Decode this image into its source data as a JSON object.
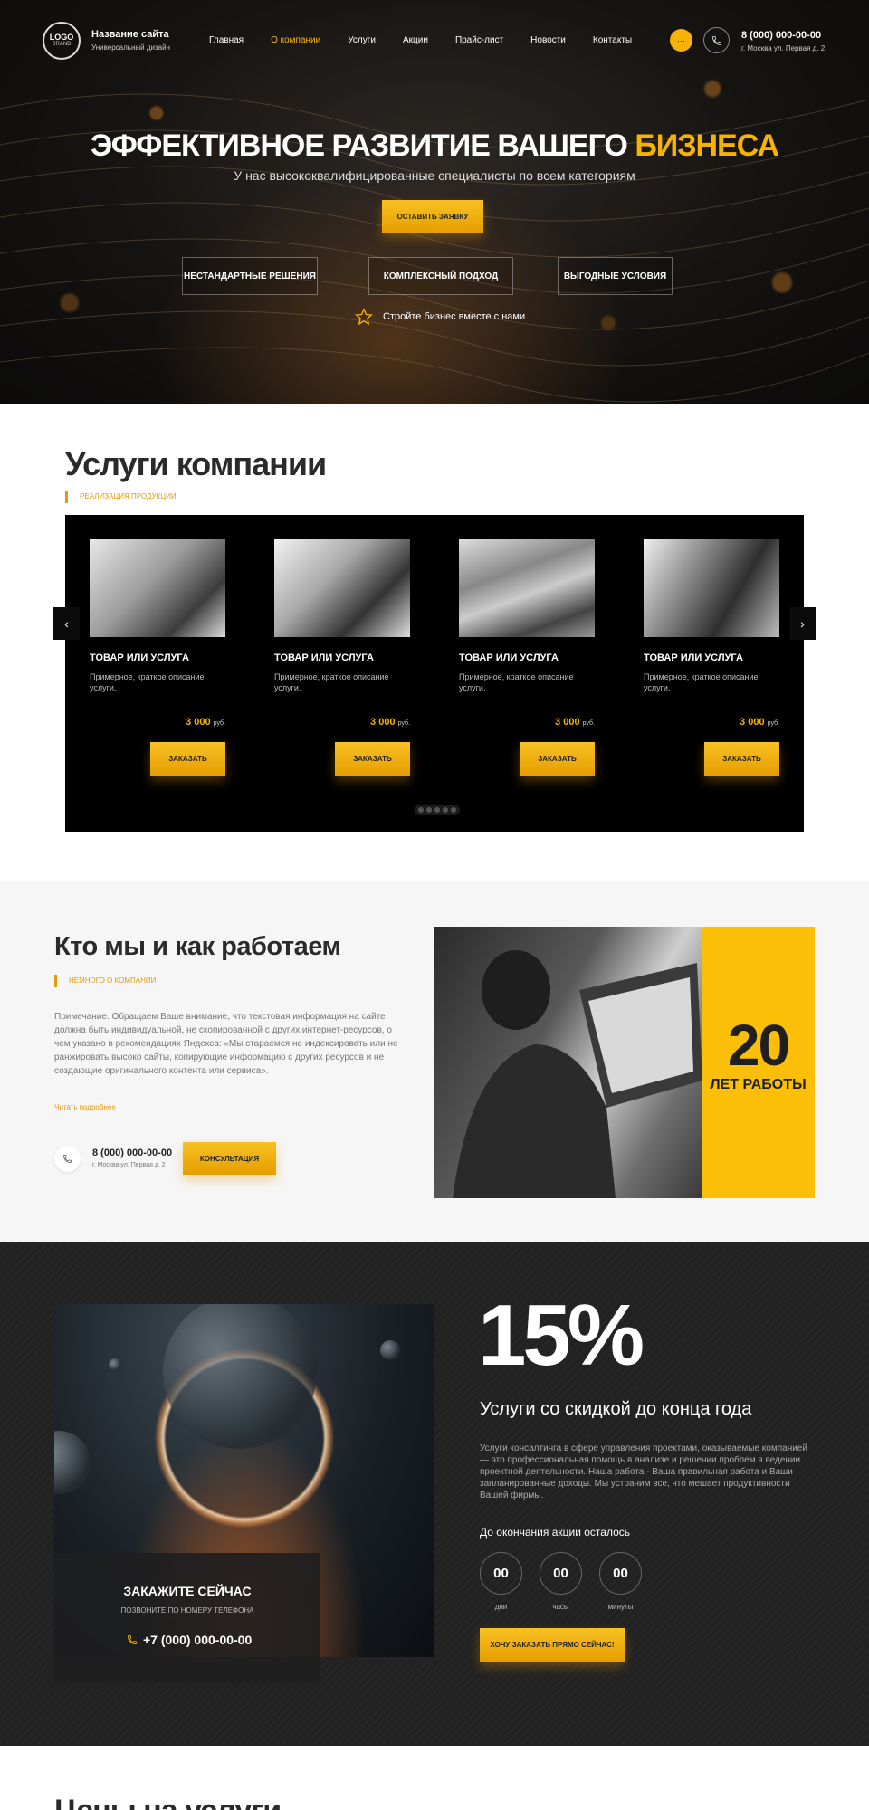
{
  "header": {
    "logo_line1": "LOGO",
    "logo_line2": "BRAND",
    "site_name": "Название сайта",
    "site_subtitle": "Универсальный дизайн",
    "nav": [
      "Главная",
      "О компании",
      "Услуги",
      "Акции",
      "Прайс-лист",
      "Новости",
      "Контакты"
    ],
    "nav_active_index": 1,
    "menu_icon": "ellipsis-icon",
    "phone": "8 (000) 000-00-00",
    "address": "г. Москва ул. Первая д. 2"
  },
  "hero": {
    "title_main": "ЭФФЕКТИВНОЕ РАЗВИТИЕ ВАШЕГО",
    "title_highlight": "БИЗНЕСА",
    "subtitle": "У нас высококвалифицированные специалисты по всем категориям",
    "button": "ОСТАВИТЬ ЗАЯВКУ",
    "features": [
      "НЕСТАНДАРТНЫЕ РЕШЕНИЯ",
      "КОМПЛЕКСНЫЙ ПОДХОД",
      "ВЫГОДНЫЕ УСЛОВИЯ"
    ],
    "cta": "Стройте бизнес вместе с нами"
  },
  "services": {
    "title": "Услуги компании",
    "label": "РЕАЛИЗАЦИЯ ПРОДУКЦИИ",
    "cards": [
      {
        "title": "ТОВАР ИЛИ УСЛУГА",
        "desc": "Примерное, краткое описание услуги.",
        "price": "3 000",
        "currency": "руб.",
        "button": "ЗАКАЗАТЬ"
      },
      {
        "title": "ТОВАР ИЛИ УСЛУГА",
        "desc": "Примерное, краткое описание услуги.",
        "price": "3 000",
        "currency": "руб.",
        "button": "ЗАКАЗАТЬ"
      },
      {
        "title": "ТОВАР ИЛИ УСЛУГА",
        "desc": "Примерное, краткое описание услуги.",
        "price": "3 000",
        "currency": "руб.",
        "button": "ЗАКАЗАТЬ"
      },
      {
        "title": "ТОВАР ИЛИ УСЛУГА",
        "desc": "Примерное, краткое описание услуги.",
        "price": "3 000",
        "currency": "руб.",
        "button": "ЗАКАЗАТЬ"
      }
    ]
  },
  "about": {
    "title": "Кто мы и как работаем",
    "label": "НЕМНОГО О КОМПАНИИ",
    "text": "Примечание. Обращаем Ваше внимание, что текстовая информация на сайте должна быть индивидуальной, не скопированной с других интернет-ресурсов, о чем указано в рекомендациях Яндекса: «Мы стараемся не индексировать или не ранжировать высоко сайты, копирующие информацию с других ресурсов и не создающие оригинального контента или сервиса».",
    "read_more": "Читать подробнее",
    "phone": "8 (000) 000-00-00",
    "address": "г. Москва ул. Первая д. 2",
    "button": "КОНСУЛЬТАЦИЯ",
    "years_number": "20",
    "years_label": "ЛЕТ РАБОТЫ"
  },
  "promo": {
    "percent": "15%",
    "title": "Услуги со скидкой до конца года",
    "text": "Услуги консалтинга в сфере управления проектами, оказываемые компанией — это профессиональная помощь в анализе и решении проблем в ведении проектной деятельности. Наша работа - Ваша правильная работа и Ваши запланированные доходы. Мы устраним все, что мешает продуктивности Вашей фирмы.",
    "countdown_label": "До окончания акции осталось",
    "timers": [
      {
        "value": "00",
        "label": "дни"
      },
      {
        "value": "00",
        "label": "часы"
      },
      {
        "value": "00",
        "label": "минуты"
      }
    ],
    "button": "ХОЧУ ЗАКАЗАТЬ ПРЯМО СЕЙЧАС!",
    "order_title": "ЗАКАЖИТЕ СЕЙЧАС",
    "order_subtitle": "ПОЗВОНИТЕ ПО НОМЕРУ ТЕЛЕФОНА",
    "order_phone": "+7 (000) 000-00-00"
  },
  "prices": {
    "title": "Цены на услуги"
  },
  "colors": {
    "accent": "#f6b301",
    "dark": "#000000",
    "promo_bg": "#232323",
    "about_bg": "#f6f6f6"
  }
}
